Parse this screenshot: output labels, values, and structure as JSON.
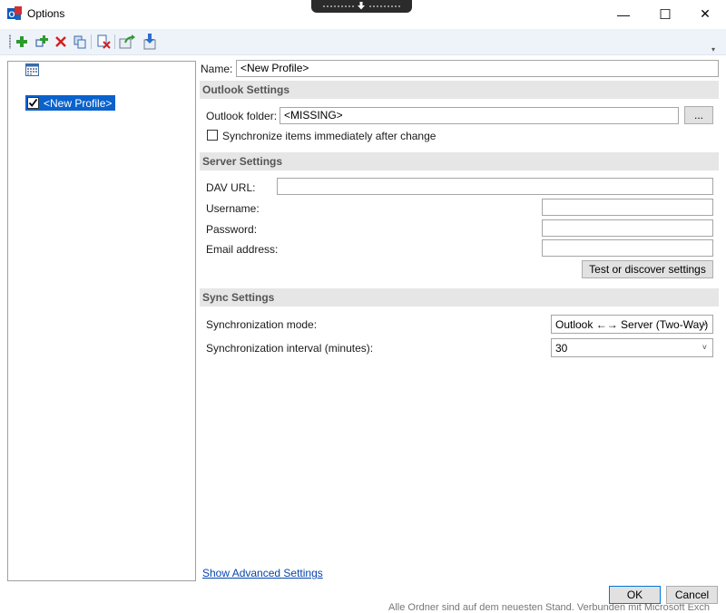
{
  "window": {
    "title": "Options"
  },
  "overlay": {
    "icon": "down-arrow-icon"
  },
  "window_controls": {
    "minimize": "—",
    "maximize": "☐",
    "close": "✕"
  },
  "toolbar": {
    "items": [
      "add-profile-icon",
      "add-multiple-profiles-icon",
      "delete-profile-icon",
      "copy-profile-icon",
      "clear-cache-icon",
      "export-options-icon",
      "import-options-icon"
    ]
  },
  "tree": {
    "root_icon": "calendar-icon",
    "profile_label": "<New Profile>",
    "profile_checked": true
  },
  "profile": {
    "name_label": "Name:",
    "name_value": "<New Profile>"
  },
  "outlook_settings": {
    "header": "Outlook Settings",
    "folder_label": "Outlook folder:",
    "folder_value": "<MISSING>",
    "browse_button": "...",
    "sync_immediately_label": "Synchronize items immediately after change",
    "sync_immediately_checked": false
  },
  "server_settings": {
    "header": "Server Settings",
    "dav_url_label": "DAV URL:",
    "dav_url_value": "",
    "username_label": "Username:",
    "username_value": "",
    "password_label": "Password:",
    "password_value": "",
    "email_label": "Email address:",
    "email_value": "",
    "test_button": "Test or discover settings"
  },
  "sync_settings": {
    "header": "Sync Settings",
    "mode_label": "Synchronization mode:",
    "mode_value": "Outlook ←→ Server (Two-Way)",
    "interval_label": "Synchronization interval (minutes):",
    "interval_value": "30"
  },
  "footer": {
    "advanced_link": "Show Advanced Settings",
    "ok_button": "OK",
    "cancel_button": "Cancel"
  },
  "background_text": "Alle Ordner sind auf dem neuesten Stand.    Verbunden mit Microsoft Exch"
}
